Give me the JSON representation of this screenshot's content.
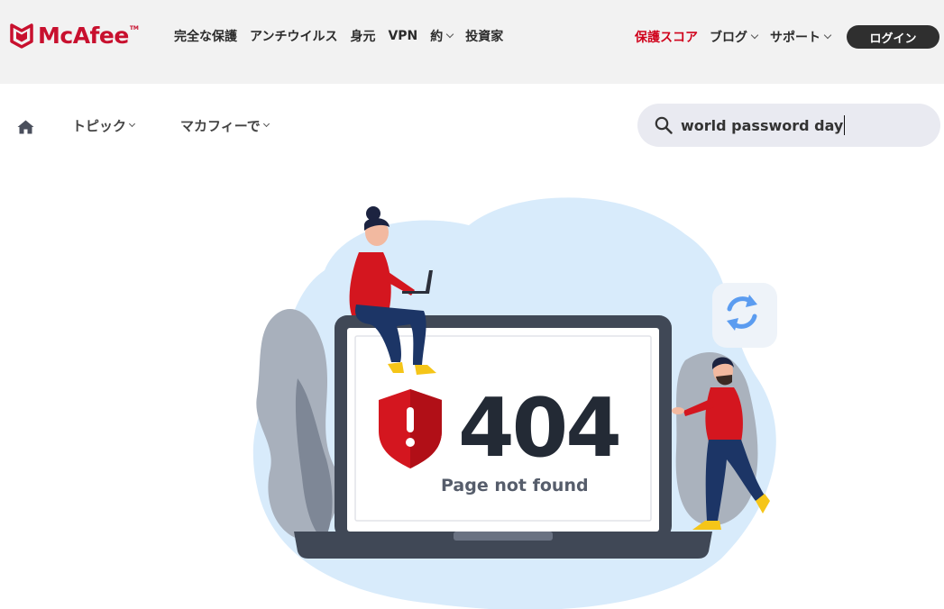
{
  "brand": {
    "name": "McAfee",
    "tm": "TM",
    "color": "#c8102e"
  },
  "top_nav": {
    "items": [
      {
        "label": "完全な保護"
      },
      {
        "label": "アンチウイルス"
      },
      {
        "label": "身元"
      },
      {
        "label": "VPN"
      },
      {
        "label": "約",
        "has_dropdown": true
      },
      {
        "label": "投資家"
      }
    ],
    "right_items": [
      {
        "label": "保護スコア",
        "highlight": true
      },
      {
        "label": "ブログ",
        "has_dropdown": true
      },
      {
        "label": "サポート",
        "has_dropdown": true
      }
    ],
    "login_label": "ログイン"
  },
  "sub_nav": {
    "home_icon": "home-icon",
    "items": [
      {
        "label": "トピック",
        "has_dropdown": true
      },
      {
        "label": "マカフィーで",
        "has_dropdown": true
      }
    ]
  },
  "search": {
    "icon": "search-icon",
    "value": "world password day"
  },
  "error": {
    "code": "404",
    "message": "Page not found",
    "icon": "shield-exclamation-icon",
    "refresh_icon": "refresh-icon"
  },
  "colors": {
    "accent_red": "#d0021b",
    "topbar_bg": "#f2f2f2",
    "search_bg": "#e9eaf1",
    "blob": "#d8ebfb",
    "laptop": "#404856"
  }
}
